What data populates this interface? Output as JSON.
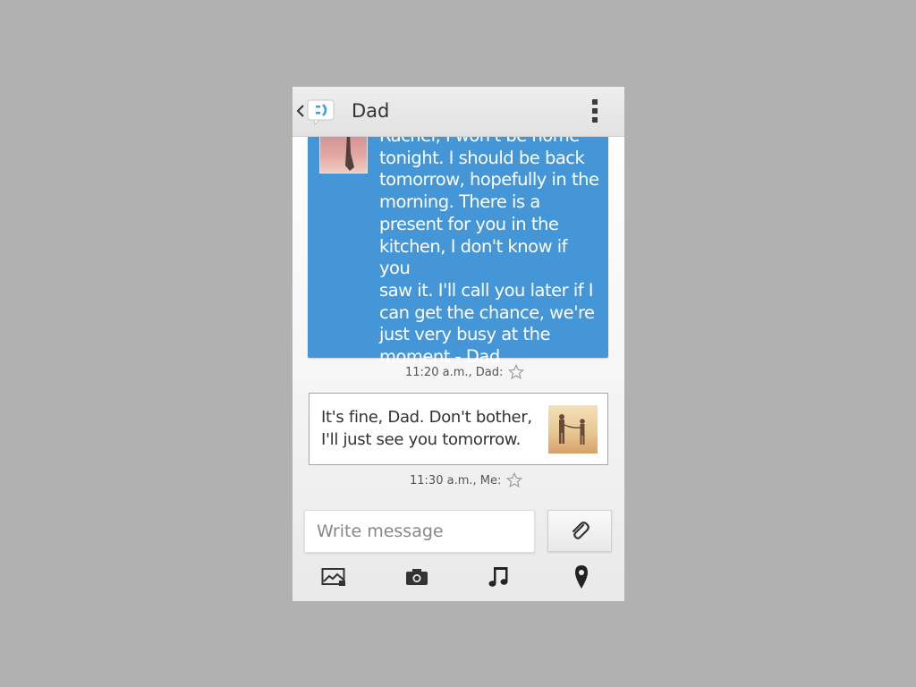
{
  "header": {
    "title": "Dad",
    "icons": [
      "chevron-left-icon",
      "messaging-app-icon",
      "overflow-menu-icon"
    ]
  },
  "thread": {
    "messages": [
      {
        "direction": "incoming",
        "text": "Rachel, I won't be home\ntonight. I should be back\ntomorrow, hopefully in the\nmorning. There is a\npresent for you in the\nkitchen, I don't know if you\nsaw it. I'll call you later if I\ncan get the chance, we're\njust very busy at the\nmoment - Dad",
        "meta": "11:20 a.m., Dad:",
        "starred": false,
        "bubble_color": "#4596d6"
      },
      {
        "direction": "outgoing",
        "text": "It's fine, Dad. Don't bother,\nI'll just see you tomorrow.",
        "meta": "11:30 a.m., Me:",
        "starred": false,
        "border_color": "#7eaede"
      }
    ]
  },
  "compose": {
    "placeholder": "Write message",
    "value": "",
    "attach_icon": "paperclip-icon",
    "media_buttons": [
      "gallery-icon",
      "camera-icon",
      "music-icon",
      "location-pin-icon"
    ]
  },
  "colors": {
    "background": "#b1b1b1",
    "accent": "#4596d6",
    "app_icon": "#3aa0d8"
  }
}
